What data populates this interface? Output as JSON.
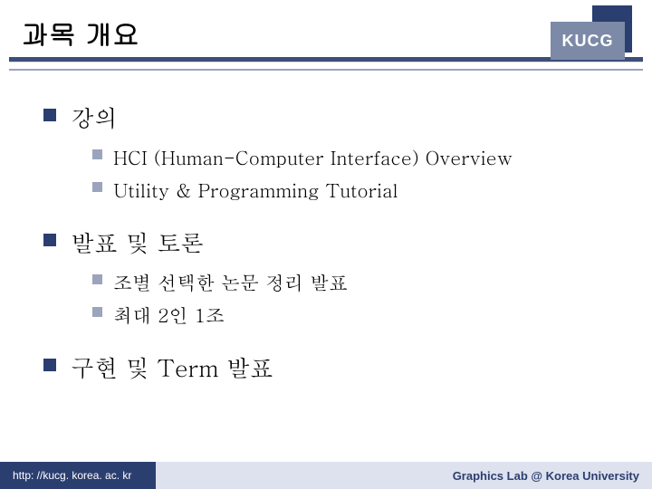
{
  "header": {
    "title": "과목 개요",
    "badge": "KUCG"
  },
  "sections": [
    {
      "label": "강의",
      "items": [
        "HCI (Human-Computer Interface) Overview",
        "Utility & Programming Tutorial"
      ]
    },
    {
      "label": "발표 및 토론",
      "items": [
        "조별 선택한 논문 정리 발표",
        "최대 2인 1조"
      ]
    },
    {
      "label": "구현 및 Term 발표",
      "items": []
    }
  ],
  "footer": {
    "url": "http: //kucg. korea. ac. kr",
    "credit": "Graphics Lab @ Korea University"
  }
}
